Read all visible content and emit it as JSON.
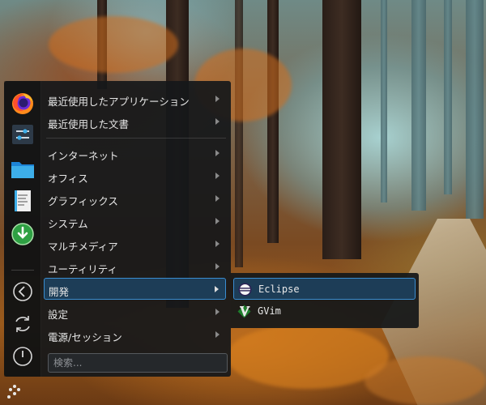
{
  "menu": {
    "items": [
      {
        "label": "最近使用したアプリケーション",
        "has_submenu": true
      },
      {
        "label": "最近使用した文書",
        "has_submenu": true
      },
      {
        "label": "インターネット",
        "has_submenu": true
      },
      {
        "label": "オフィス",
        "has_submenu": true
      },
      {
        "label": "グラフィックス",
        "has_submenu": true
      },
      {
        "label": "システム",
        "has_submenu": true
      },
      {
        "label": "マルチメディア",
        "has_submenu": true
      },
      {
        "label": "ユーティリティ",
        "has_submenu": true
      },
      {
        "label": "開発",
        "has_submenu": true,
        "active": true
      },
      {
        "label": "設定",
        "has_submenu": true
      },
      {
        "label": "電源/セッション",
        "has_submenu": true
      }
    ],
    "search_placeholder": "検索..."
  },
  "favorites": [
    {
      "icon": "firefox-icon"
    },
    {
      "icon": "system-settings-icon"
    },
    {
      "icon": "file-manager-icon"
    },
    {
      "icon": "text-editor-icon"
    },
    {
      "icon": "software-update-icon"
    }
  ],
  "session_controls": [
    {
      "icon": "logout-icon"
    },
    {
      "icon": "restart-icon"
    },
    {
      "icon": "shutdown-icon"
    }
  ],
  "submenu": {
    "items": [
      {
        "label": "Eclipse",
        "icon": "eclipse-icon",
        "active": true
      },
      {
        "label": "GVim",
        "icon": "gvim-icon"
      }
    ]
  },
  "colors": {
    "menu_bg": "#16181a",
    "highlight_bg": "#1d3d57",
    "highlight_border": "#3a8dd0"
  }
}
